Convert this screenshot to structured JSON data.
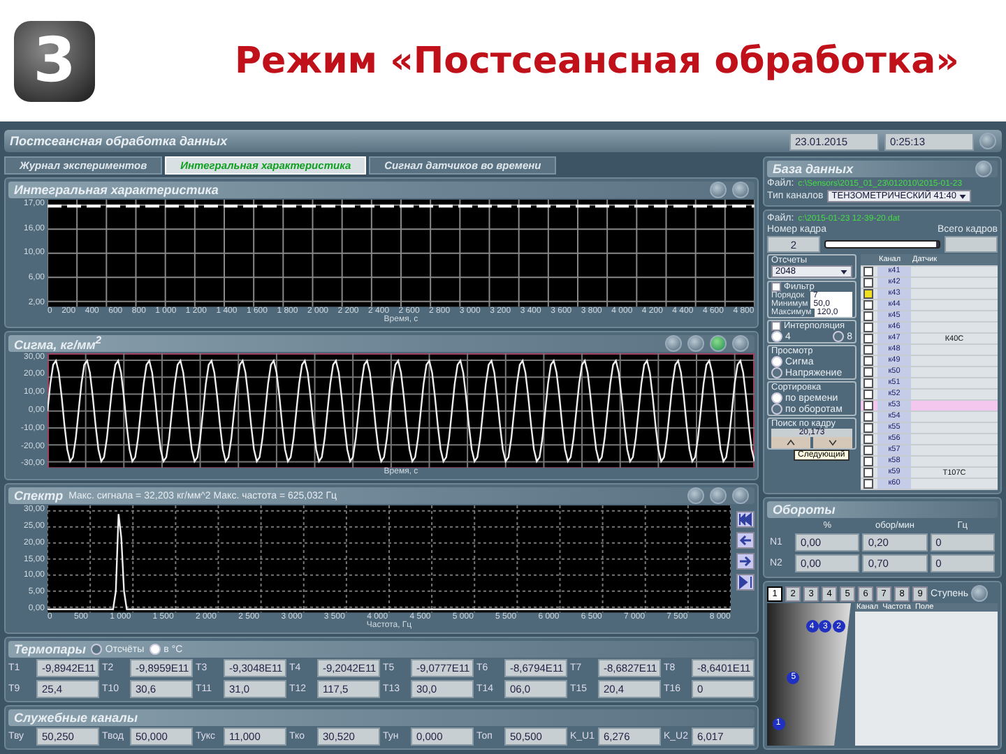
{
  "slide": {
    "logo": "3",
    "title": "Режим «Постсеансная обработка»"
  },
  "window": {
    "title": "Постсеансная обработка данных",
    "date": "23.01.2015",
    "time": "0:25:13"
  },
  "tabs": [
    {
      "label": "Журнал экспериментов",
      "selected": false
    },
    {
      "label": "Интегральная характеристика",
      "selected": true
    },
    {
      "label": "Сигнал датчиков во времени",
      "selected": false
    }
  ],
  "integral": {
    "title": "Интегральная характеристика",
    "yticks": [
      "17,00",
      "16,00",
      "10,00",
      "6,00",
      "2,00"
    ],
    "xticks": [
      "0",
      "200",
      "400",
      "600",
      "800",
      "1 000",
      "1 200",
      "1 400",
      "1 600",
      "1 800",
      "2 000",
      "2 200",
      "2 400",
      "2 600",
      "2 800",
      "3 000",
      "3 200",
      "3 400",
      "3 600",
      "3 800",
      "4 000",
      "4 200",
      "4 400",
      "4 600",
      "4 800"
    ],
    "xlabel": "Время, с"
  },
  "sigma": {
    "title": "Сигма, кг/мм$^{2}$",
    "yticks": [
      "30,00",
      "20,00",
      "10,00",
      "0,00",
      "-10,00",
      "-20,00",
      "-30,00"
    ],
    "xlabel": "Время, с"
  },
  "spectrum": {
    "title": "Спектр",
    "info": "Макс. сигнала = 32,203 кг/мм^2  Макс. частота = 625,032 Гц",
    "yticks": [
      "30,00",
      "25,00",
      "20,00",
      "15,00",
      "10,00",
      "5,00",
      "0,00"
    ],
    "xticks": [
      "0",
      "500",
      "1 000",
      "1 500",
      "2 000",
      "2 500",
      "3 000",
      "3 500",
      "4 000",
      "4 500",
      "5 000",
      "5 500",
      "6 000",
      "6 500",
      "7 000",
      "7 500",
      "8 000"
    ],
    "xlabel": "Частота, Гц"
  },
  "thermocouples": {
    "title": "Термопары",
    "modes": [
      {
        "label": "Отсчёты",
        "selected": false
      },
      {
        "label": "в °С",
        "selected": true
      }
    ],
    "fields": [
      {
        "label": "T1",
        "value": "-9,8942E11"
      },
      {
        "label": "T2",
        "value": "-9,8959E11"
      },
      {
        "label": "T3",
        "value": "-9,3048E11"
      },
      {
        "label": "T4",
        "value": "-9,2042E11"
      },
      {
        "label": "T5",
        "value": "-9,0777E11"
      },
      {
        "label": "T6",
        "value": "-8,6794E11"
      },
      {
        "label": "T7",
        "value": "-8,6827E11"
      },
      {
        "label": "T8",
        "value": "-8,6401E11"
      },
      {
        "label": "T9",
        "value": "25,4"
      },
      {
        "label": "T10",
        "value": "30,6"
      },
      {
        "label": "T11",
        "value": "31,0"
      },
      {
        "label": "T12",
        "value": "117,5"
      },
      {
        "label": "T13",
        "value": "30,0"
      },
      {
        "label": "T14",
        "value": "06,0"
      },
      {
        "label": "T15",
        "value": "20,4"
      },
      {
        "label": "T16",
        "value": "0"
      }
    ]
  },
  "service": {
    "title": "Служебные каналы",
    "fields": [
      {
        "label": "Тву",
        "value": "50,250"
      },
      {
        "label": "Твод",
        "value": "50,000"
      },
      {
        "label": "Тукс",
        "value": "11,000"
      },
      {
        "label": "Тко",
        "value": "30,520"
      },
      {
        "label": "Тун",
        "value": "0,000"
      },
      {
        "label": "Топ",
        "value": "50,500"
      },
      {
        "label": "K_U1",
        "value": "6,276"
      },
      {
        "label": "K_U2",
        "value": "6,017"
      }
    ]
  },
  "database": {
    "title": "База данных",
    "file_label": "Файл:",
    "file": "c:\\Sensors\\2015_01_23\\012010\\2015-01-23",
    "type_label": "Тип каналов",
    "type": "ТЕНЗОМЕТРИЧЕСКИЙ 41:40",
    "frame_file_label": "Файл:",
    "frame_file": "c:\\2015-01-23 12-39-20.dat",
    "frame_label": "Номер кадра",
    "frame": "2",
    "total_label": "Всего кадров",
    "slider": {
      "level": 0.97
    },
    "samples": {
      "title": "Отсчеты",
      "value": "2048"
    },
    "filter": {
      "title": "Фильтр",
      "checked": false,
      "fields": [
        {
          "label": "Порядок",
          "value": "7"
        },
        {
          "label": "Минимум",
          "value": "50,0"
        },
        {
          "label": "Максимум",
          "value": "120,0"
        }
      ]
    },
    "interpolation": {
      "title": "Интерполяция",
      "checked": false,
      "options": [
        {
          "label": "4",
          "selected": true
        },
        {
          "label": "8",
          "selected": false
        }
      ]
    },
    "view": {
      "title": "Просмотр",
      "options": [
        {
          "label": "Сигма",
          "selected": true
        },
        {
          "label": "Напряжение",
          "selected": false
        }
      ]
    },
    "sort": {
      "title": "Сортировка",
      "options": [
        {
          "label": "по времени",
          "selected": true
        },
        {
          "label": "по оборотам",
          "selected": false
        }
      ]
    },
    "search": {
      "title": "Поиск по кадру",
      "value": "20,173",
      "tooltip": "Следующий"
    },
    "columns": [
      "Канал",
      "Датчик"
    ],
    "channels": [
      {
        "name": "к41",
        "checked": false,
        "selected": false
      },
      {
        "name": "к42",
        "checked": false,
        "selected": false
      },
      {
        "name": "к43",
        "checked": true,
        "selected": false
      },
      {
        "name": "к44",
        "checked": false,
        "selected": false
      },
      {
        "name": "к45",
        "checked": false,
        "selected": false
      },
      {
        "name": "к46",
        "checked": false,
        "selected": false
      },
      {
        "name": "к47",
        "sensor": "К40С",
        "checked": false,
        "selected": false
      },
      {
        "name": "к48",
        "checked": false,
        "selected": false
      },
      {
        "name": "к49",
        "checked": false,
        "selected": false
      },
      {
        "name": "к50",
        "checked": false,
        "selected": false
      },
      {
        "name": "к51",
        "checked": false,
        "selected": false
      },
      {
        "name": "к52",
        "checked": false,
        "selected": false
      },
      {
        "name": "к53",
        "checked": false,
        "selected": true
      },
      {
        "name": "к54",
        "checked": false,
        "selected": false
      },
      {
        "name": "к55",
        "checked": false,
        "selected": false
      },
      {
        "name": "к56",
        "checked": false,
        "selected": false
      },
      {
        "name": "к57",
        "checked": false,
        "selected": false
      },
      {
        "name": "к58",
        "checked": false,
        "selected": false
      },
      {
        "name": "к59",
        "sensor": "Т107С",
        "checked": false,
        "selected": false
      },
      {
        "name": "к60",
        "checked": false,
        "selected": false
      }
    ]
  },
  "rpm": {
    "title": "Обороты",
    "columns": [
      "%",
      "обор/мин",
      "Гц"
    ],
    "rows": [
      {
        "label": "N1",
        "values": [
          "0,00",
          "0,20",
          "0"
        ]
      },
      {
        "label": "N2",
        "values": [
          "0,00",
          "0,70",
          "0"
        ]
      }
    ]
  },
  "stages": {
    "buttons": [
      {
        "label": "1",
        "selected": true
      },
      {
        "label": "2",
        "selected": false
      },
      {
        "label": "3",
        "selected": false
      },
      {
        "label": "4",
        "selected": false
      },
      {
        "label": "5",
        "selected": false
      },
      {
        "label": "6",
        "selected": false
      },
      {
        "label": "7",
        "selected": false
      },
      {
        "label": "8",
        "selected": false
      },
      {
        "label": "9",
        "selected": false
      }
    ],
    "label": "Ступень",
    "markers": [
      "4",
      "3",
      "2",
      "5",
      "1"
    ],
    "columns": [
      "Канал",
      "Частота",
      "Поле"
    ]
  }
}
